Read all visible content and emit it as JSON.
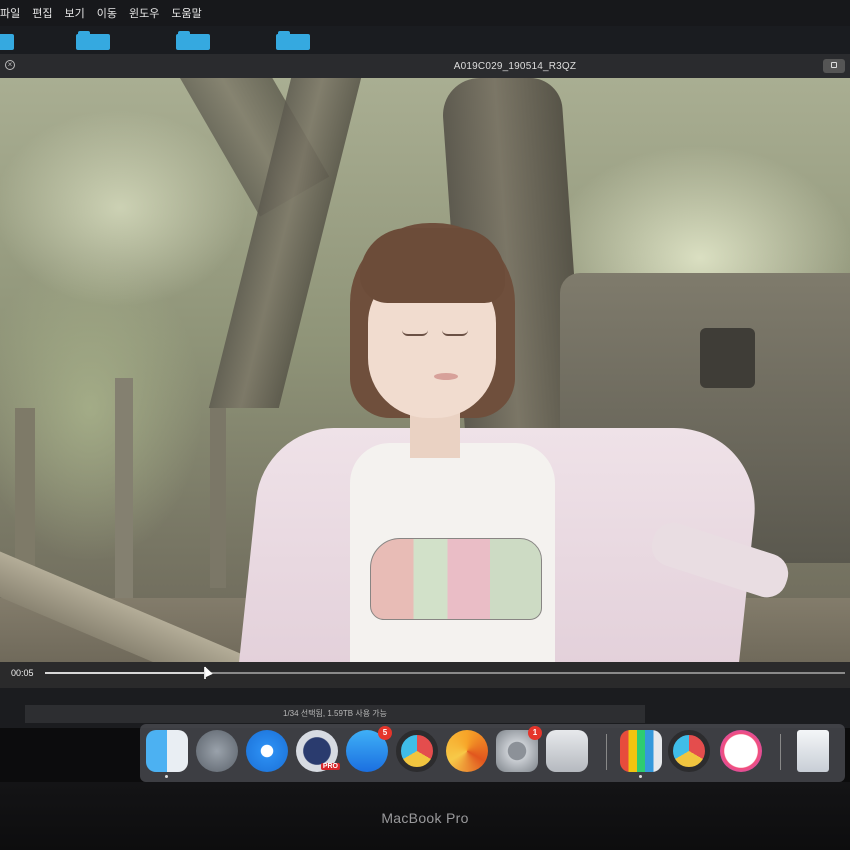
{
  "menubar": {
    "items": [
      "파일",
      "편집",
      "보기",
      "이동",
      "윈도우",
      "도움말"
    ]
  },
  "window": {
    "title": "A019C029_190514_R3QZ"
  },
  "player": {
    "current_time": "00:05",
    "progress": 0.2
  },
  "finder": {
    "status_text": "1/34 선택됨, 1.59TB 사용 가능"
  },
  "dock": {
    "apps": [
      {
        "name": "Finder",
        "icon": "finder-icon"
      },
      {
        "name": "Launchpad",
        "icon": "launchpad-icon"
      },
      {
        "name": "Safari",
        "icon": "safari-icon"
      },
      {
        "name": "Final Cut Pro",
        "icon": "final-cut-pro-icon",
        "tag": "PRO"
      },
      {
        "name": "App Store",
        "icon": "app-store-icon",
        "badge": "5"
      },
      {
        "name": "DaVinci Resolve",
        "icon": "davinci-resolve-icon"
      },
      {
        "name": "Infuse",
        "icon": "infuse-icon"
      },
      {
        "name": "System Preferences",
        "icon": "system-preferences-icon",
        "badge": "1"
      },
      {
        "name": "Disk Utility",
        "icon": "disk-utility-icon"
      },
      {
        "name": "Stats",
        "icon": "bar-chart-icon"
      },
      {
        "name": "DaVinci Resolve",
        "icon": "davinci-resolve-icon"
      },
      {
        "name": "iTunes",
        "icon": "itunes-icon"
      },
      {
        "name": "Document",
        "icon": "document-icon"
      }
    ]
  },
  "device": {
    "brand": "MacBook Pro"
  },
  "colors": {
    "menubar_bg": "#17181b",
    "folder": "#35a9e0",
    "badge": "#e5352b"
  }
}
